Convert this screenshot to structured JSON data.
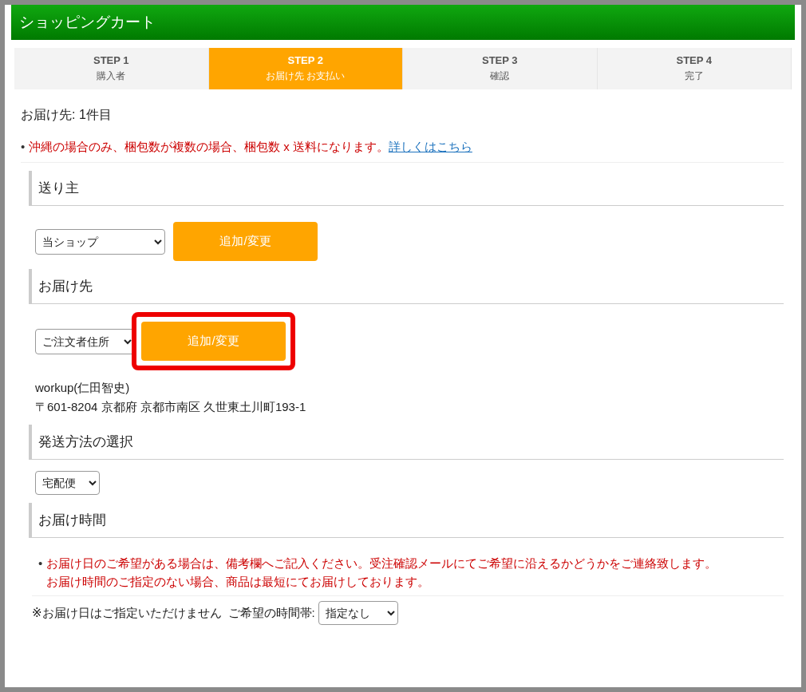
{
  "header": {
    "title": "ショッピングカート"
  },
  "steps": [
    {
      "label": "STEP 1",
      "caption": "購入者",
      "selected": false
    },
    {
      "label": "STEP 2",
      "caption": "お届け先 お支払い",
      "selected": true
    },
    {
      "label": "STEP 3",
      "caption": "確認",
      "selected": false
    },
    {
      "label": "STEP 4",
      "caption": "完了",
      "selected": false
    }
  ],
  "page_heading": "お届け先: 1件目",
  "notice": {
    "bullet": "•",
    "text": "沖縄の場合のみ、梱包数が複数の場合、梱包数 x 送料になります。",
    "link": "詳しくはこちら"
  },
  "sender": {
    "heading": "送り主",
    "select_value": "当ショップ",
    "button": "追加/変更",
    "highlighted": false
  },
  "destination": {
    "heading": "お届け先",
    "select_value": "ご注文者住所",
    "button": "追加/変更",
    "highlighted": true,
    "name": "workup(仁田智史)",
    "address": "〒601-8204 京都府 京都市南区 久世東土川町193-1"
  },
  "shipping": {
    "heading": "発送方法の選択",
    "select_value": "宅配便"
  },
  "delivery_time": {
    "heading": "お届け時間",
    "bullet": "•",
    "notes": [
      "お届け日のご希望がある場合は、備考欄へご記入ください。受注確認メールにてご希望に沿えるかどうかをご連絡致します。",
      "お届け時間のご指定のない場合、商品は最短にてお届けしております。"
    ],
    "date_note": "※お届け日はご指定いただけません",
    "time_label": "ご希望の時間帯:",
    "time_value": "指定なし"
  }
}
